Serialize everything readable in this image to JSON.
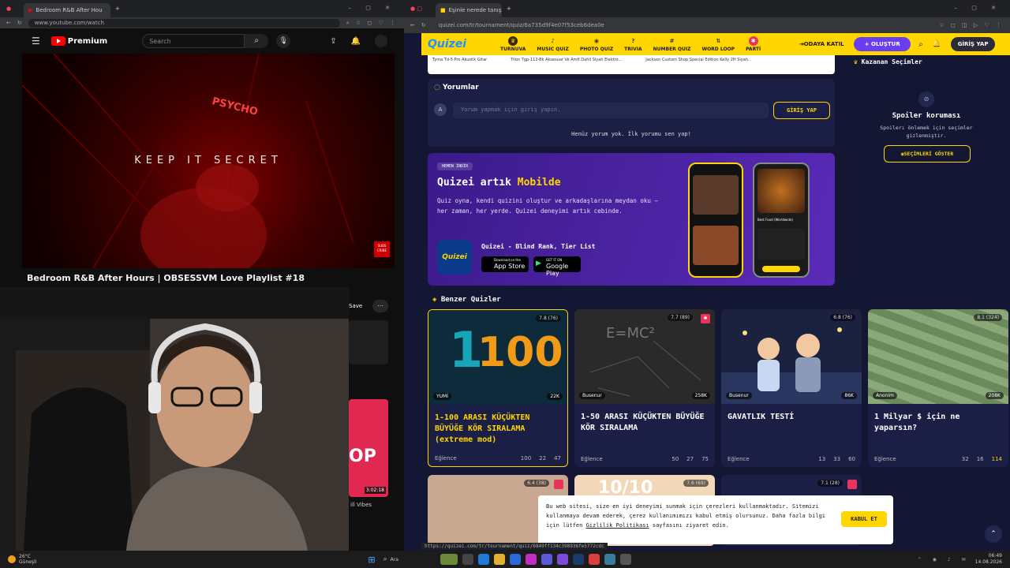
{
  "left_browser": {
    "tab_title": "Bedroom R&B After Hou",
    "url": "www.youtube.com/watch",
    "brand": "Premium",
    "search_placeholder": "Search",
    "video_overlay_text": "KEEP IT SECRET",
    "psycho_text": "PSYCHO",
    "subscribe_text": "SUBS CRIBE",
    "video_title": "Bedroom R&B After Hours | OBSESSVM Love Playlist #18",
    "save_label": "Save",
    "side_duration": "3:02:18",
    "side_text": "ill Vibes",
    "side_thumb_text": "OP"
  },
  "right_browser": {
    "tab_title": "Eşinle nerede tanışmak iste",
    "url": "quizei.com/tr/tournament/quiz/6a735d9f4e07f53ceb6dea0e",
    "logo": "Quizei",
    "nav": [
      {
        "label": "TURNUVA",
        "icon": "trophy-icon"
      },
      {
        "label": "MUSIC QUIZ",
        "icon": "music-icon"
      },
      {
        "label": "PHOTO QUIZ",
        "icon": "camera-icon"
      },
      {
        "label": "TRIVIA",
        "icon": "question-icon"
      },
      {
        "label": "NUMBER QUIZ",
        "icon": "hash-icon"
      },
      {
        "label": "WORD LOOP",
        "icon": "sort-icon"
      },
      {
        "label": "PARTİ",
        "icon": "party-icon"
      }
    ],
    "join_room": "ODAYA KATIL",
    "create": "+ OLUŞTUR",
    "login": "GİRİŞ YAP",
    "products": [
      "Tyma Td-5 Pro Akustik Gitar",
      "Trion Tgp-112-Bk Aksesuar Ve Amfi Dahil Siyah Elektro...",
      "Jackson Custom Shop Special Edition Kelly 2H Siyah..."
    ],
    "comments": {
      "header": "Yorumlar",
      "avatar": "A",
      "placeholder": "Yorum yapmak için giriş yapın.",
      "login_btn": "GİRİŞ YAP",
      "empty": "Henüz yorum yok. İlk yorumu sen yap!"
    },
    "promo": {
      "tag": "HEMEN İNDİR",
      "title_a": "Quizei artık ",
      "title_b": "Mobilde",
      "body": "Quiz oyna, kendi quizini oluştur ve arkadaşlarına meydan oku — her zaman, her yerde. Quizei deneyimi artık cebinde.",
      "app_name": "Quizei - Blind Rank, Tier List",
      "app_store": "App Store",
      "app_store_small": "Download on the",
      "google_play": "Google Play",
      "google_play_small": "GET IT ON",
      "phone_label": "Best Food (Worldwide)"
    },
    "side_panel": {
      "header": "Kazanan Seçimler",
      "spoiler_title": "Spoiler koruması",
      "spoiler_desc": "Spoilerı önlemek için seçimler gizlenmiştir.",
      "show_btn": "SEÇİMLERİ GÖSTER"
    },
    "similar_header": "Benzer Quizler",
    "cards": [
      {
        "title": "1-100 ARASI KÜÇÜKTEN BÜYÜĞE KÖR SIRALAMA (extreme mod)",
        "rating": "7.8 (76)",
        "author": "YUMİ",
        "plays": "22K",
        "category": "Eğlence",
        "items": "100",
        "comments": "22",
        "likes": "47",
        "thumb_text_a": "1",
        "thumb_text_b": "100"
      },
      {
        "title": "1-50 ARASI KÜÇÜKTEN BÜYÜĞE KÖR SIRALAMA",
        "rating": "7.7 (89)",
        "author": "Busenur",
        "plays": "258K",
        "category": "Eğlence",
        "items": "50",
        "comments": "27",
        "likes": "75",
        "thumb_text_a": "E=MC²"
      },
      {
        "title": "GAVATLIK TESTİ",
        "rating": "6.8 (76)",
        "author": "Busenur",
        "plays": "86K",
        "category": "Eğlence",
        "items": "13",
        "comments": "33",
        "likes": "60"
      },
      {
        "title": "1 Milyar $ için ne yaparsın?",
        "rating": "8.1 (324)",
        "author": "Anonim",
        "plays": "208K",
        "category": "Eğlence",
        "items": "32",
        "comments": "16",
        "likes": "114"
      }
    ],
    "row2_ratings": [
      "6.4 (38)",
      "7.6 (69)",
      "7.1 (28)"
    ],
    "row2_thumb_text": "10/10",
    "cookie": {
      "text": "Bu web sitesi, size en iyi deneyimi sunmak için çerezleri kullanmaktadır. Sitemizi kullanmaya devam ederek, çerez kullanımımızı kabul etmiş olursunuz. Daha fazla bilgi için lütfen ",
      "link": "Gizlilik Politikası",
      "text_end": " sayfasını ziyaret edin.",
      "button": "KABUL ET"
    },
    "status_url": "https://quizei.com/tr/tournament/quiz/6849ff134c398936fe5772cdc"
  },
  "taskbar": {
    "weather": "26°C",
    "weather_desc": "Güneşli",
    "search": "Ara",
    "time": "06:49",
    "date": "14.08.2026"
  },
  "colors": {
    "accent": "#ffd600",
    "bg": "#141734",
    "card": "#1b1f45",
    "purple": "#6a3df0"
  }
}
